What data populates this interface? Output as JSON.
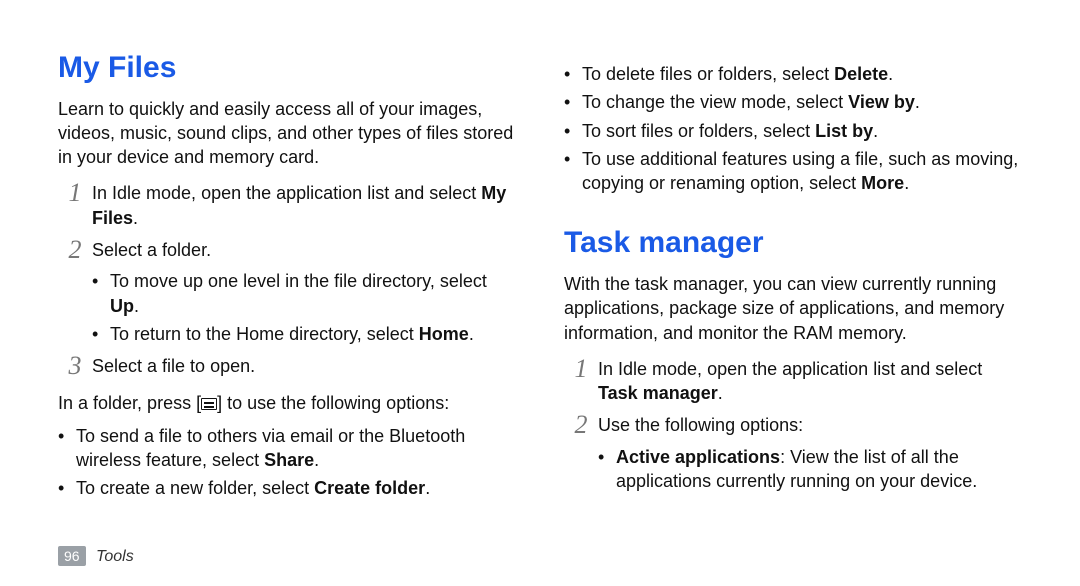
{
  "footer": {
    "page": "96",
    "section": "Tools"
  },
  "left": {
    "title": "My Files",
    "intro": "Learn to quickly and easily access all of your images, videos, music, sound clips, and other types of files stored in your device and memory card.",
    "step1_a": "In Idle mode, open the application list and select ",
    "step1_b": "My Files",
    "step1_c": ".",
    "step2": "Select a folder.",
    "step2_sub1_a": "To move up one level in the file directory, select ",
    "step2_sub1_b": "Up",
    "step2_sub1_c": ".",
    "step2_sub2_a": "To return to the Home directory, select ",
    "step2_sub2_b": "Home",
    "step2_sub2_c": ".",
    "step3": "Select a file to open.",
    "folder_press_a": "In a folder, press [",
    "folder_press_b": "] to use the following options:",
    "opt1_a": "To send a file to others via email or the Bluetooth wireless feature, select ",
    "opt1_b": "Share",
    "opt1_c": ".",
    "opt2_a": "To create a new folder, select ",
    "opt2_b": "Create folder",
    "opt2_c": "."
  },
  "right": {
    "extra1_a": "To delete files or folders, select ",
    "extra1_b": "Delete",
    "extra1_c": ".",
    "extra2_a": "To change the view mode, select ",
    "extra2_b": "View by",
    "extra2_c": ".",
    "extra3_a": "To sort files or folders, select ",
    "extra3_b": "List by",
    "extra3_c": ".",
    "extra4_a": "To use additional features using a file, such as moving, copying or renaming option, select ",
    "extra4_b": "More",
    "extra4_c": ".",
    "tm_title": "Task manager",
    "tm_intro": "With the task manager, you can view currently running applications, package size of applications, and memory information, and monitor the RAM memory.",
    "tm_step1_a": "In Idle mode, open the application list and select ",
    "tm_step1_b": "Task manager",
    "tm_step1_c": ".",
    "tm_step2": "Use the following options:",
    "tm_opt1_a": "Active applications",
    "tm_opt1_b": ": View the list of all the applications currently running on your device."
  }
}
